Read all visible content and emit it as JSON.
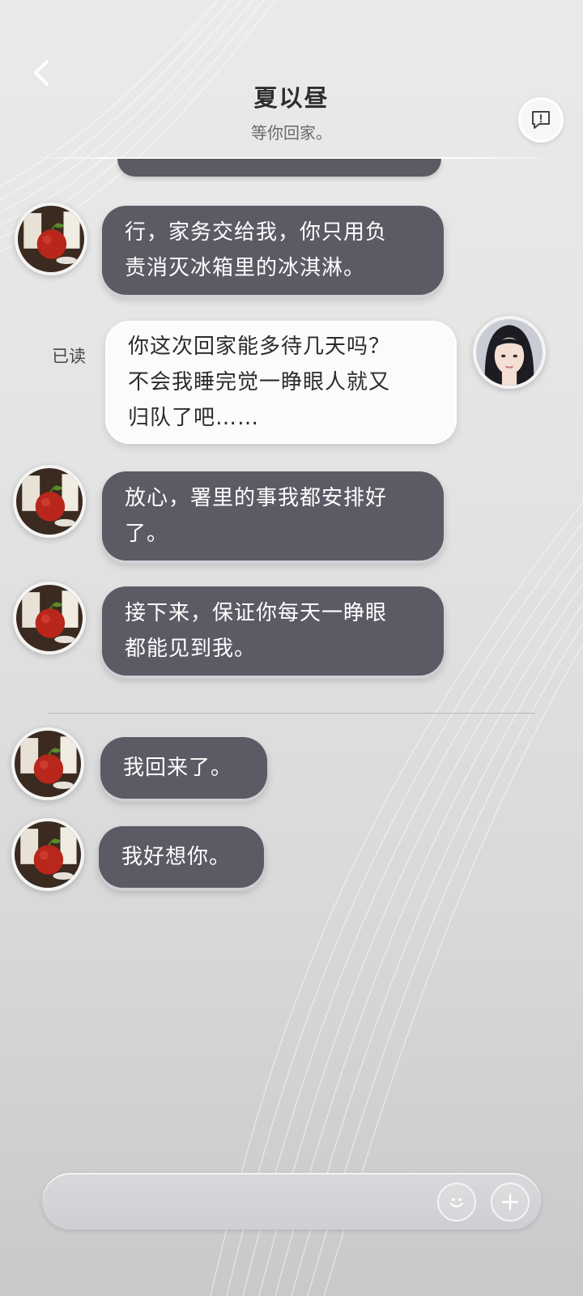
{
  "header": {
    "title": "夏以昼",
    "subtitle": "等你回家。",
    "back_icon": "chevron-left-icon",
    "feedback_icon": "message-alert-icon"
  },
  "messages": [
    {
      "side": "incoming",
      "text": "行，家务交给我，你只用负责消灭冰箱里的冰淇淋。",
      "lines": [
        "行，家务交给我，你只用负",
        "责消灭冰箱里的冰淇淋。"
      ]
    },
    {
      "side": "outgoing",
      "status": "已读",
      "text": "你这次回家能多待几天吗？不会我睡完觉一睁眼人就又归队了吧……",
      "lines": [
        "你这次回家能多待几天吗？",
        "不会我睡完觉一睁眼人就又",
        "归队了吧……"
      ]
    },
    {
      "side": "incoming",
      "text": "放心，署里的事我都安排好了。",
      "lines": [
        "放心，署里的事我都安排好",
        "了。"
      ]
    },
    {
      "side": "incoming",
      "text": "接下来，保证你每天一睁眼都能见到我。",
      "lines": [
        "接下来，保证你每天一睁眼",
        "都能见到我。"
      ]
    },
    {
      "side": "incoming",
      "text": "我回来了。",
      "lines": [
        "我回来了。"
      ]
    },
    {
      "side": "incoming",
      "text": "我好想你。",
      "lines": [
        "我好想你。"
      ]
    }
  ],
  "input": {
    "value": "",
    "emoji_icon": "smiley-icon",
    "plus_icon": "plus-icon"
  },
  "colors": {
    "incoming_bubble": "#5b5b66",
    "outgoing_bubble": "#fbfbfb",
    "incoming_text": "#ffffff",
    "outgoing_text": "#2c2c2e"
  }
}
